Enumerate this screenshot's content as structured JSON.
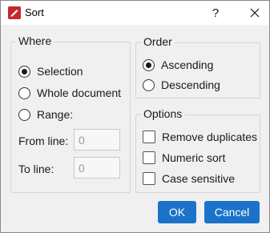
{
  "window": {
    "title": "Sort",
    "help_label": "?",
    "app_icon": "app-logo-icon",
    "close_icon": "close-icon"
  },
  "where": {
    "title": "Where",
    "options": [
      {
        "label": "Selection",
        "checked": true
      },
      {
        "label": "Whole document",
        "checked": false
      },
      {
        "label": "Range:",
        "checked": false
      }
    ],
    "from_label": "From line:",
    "from_value": "0",
    "to_label": "To line:",
    "to_value": "0"
  },
  "order": {
    "title": "Order",
    "options": [
      {
        "label": "Ascending",
        "checked": true
      },
      {
        "label": "Descending",
        "checked": false
      }
    ]
  },
  "options": {
    "title": "Options",
    "items": [
      {
        "label": "Remove duplicates",
        "checked": false
      },
      {
        "label": "Numeric sort",
        "checked": false
      },
      {
        "label": "Case sensitive",
        "checked": false
      }
    ]
  },
  "buttons": {
    "ok": "OK",
    "cancel": "Cancel"
  },
  "colors": {
    "accent": "#1a73c9",
    "app_icon": "#c8282d"
  }
}
